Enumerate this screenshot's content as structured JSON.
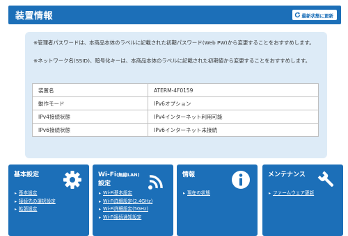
{
  "header": {
    "title": "装置情報",
    "refresh_label": "最新状態に更新"
  },
  "notes": {
    "admin_password": "※管理者パスワードは、本商品本体のラベルに記載された初期パスワード(Web PW)から変更することをおすすめします。",
    "ssid_key": "※ネットワーク名(SSID)、暗号化キーは、本商品本体のラベルに記載された初期値から変更することをおすすめします。"
  },
  "device_table": [
    {
      "label": "装置名",
      "value": "ATERM-4F0159"
    },
    {
      "label": "動作モード",
      "value": "IPv6オプション"
    },
    {
      "label": "IPv4接続状態",
      "value": "IPv4インターネット利用可能"
    },
    {
      "label": "IPv6接続状態",
      "value": "IPv6インターネット未接続"
    }
  ],
  "cards": {
    "basic": {
      "title": "基本設定",
      "icon": "gear-icon",
      "links": [
        "基本設定",
        "接続先の選択設定",
        "拡張設定"
      ]
    },
    "wifi": {
      "title_main": "Wi-Fi",
      "title_sub": "(無線LAN)",
      "title_line2": "設定",
      "icon": "wifi-signal-icon",
      "links": [
        "Wi-Fi基本設定",
        "Wi-Fi詳細設定(2.4GHz)",
        "Wi-Fi詳細設定(5GHz)",
        "Wi-Fi接続通知設定"
      ]
    },
    "info": {
      "title": "情報",
      "icon": "info-icon",
      "links": [
        "現在の状態"
      ]
    },
    "maintenance": {
      "title": "メンテナンス",
      "icon": "wrench-icon",
      "links": [
        "ファームウェア更新"
      ]
    }
  },
  "colors": {
    "primary": "#1c6fb8",
    "panel_bg": "#ddebf7"
  }
}
